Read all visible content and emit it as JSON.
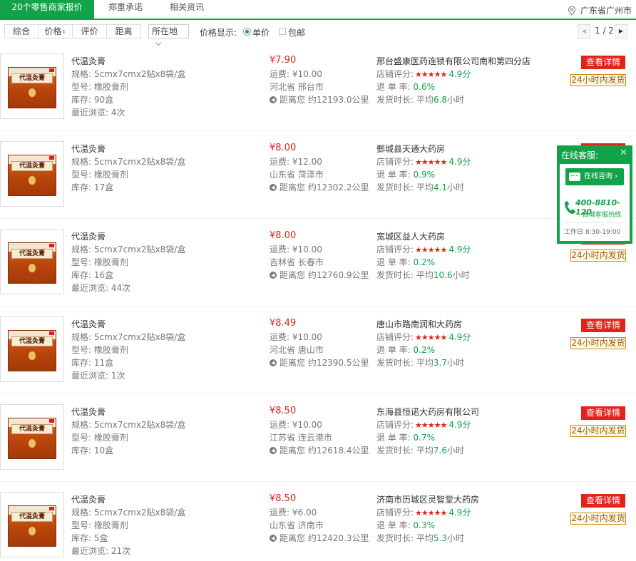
{
  "tabs": [
    {
      "label": "20个零售商家报价",
      "active": true
    },
    {
      "label": "郑重承诺",
      "active": false
    },
    {
      "label": "相关资讯",
      "active": false
    }
  ],
  "location": "广东省广州市",
  "filters": {
    "buttons": [
      "综合",
      "价格",
      "评价",
      "距离"
    ],
    "region_select": "所在地",
    "price_display_label": "价格显示:",
    "unit_price_label": "单价",
    "shipping_label": "包邮"
  },
  "pager": {
    "text": "1 / 2"
  },
  "labels": {
    "spec": "规格:",
    "type": "型号:",
    "stock": "库存:",
    "recent": "最近浏览:",
    "shipping": "运费:",
    "distance_prefix": "距离您 约",
    "rating": "店铺评分:",
    "return_rate": "退 单 率:",
    "ship_time": "发货时长:",
    "avg": "平均",
    "hours": "小时",
    "detail": "查看详情",
    "ship24": "24小时内发货"
  },
  "products": [
    {
      "name": "代温灸膏",
      "spec": "5cmx7cmx2贴x8袋/盒",
      "type": "橡胶膏剂",
      "stock": "90盒",
      "recent": "4次",
      "price": "¥7.90",
      "shipping": "¥10.00",
      "region": "河北省 邢台市",
      "distance": "12193.0公里",
      "store": "邢台盛康医药连锁有限公司南和第四分店",
      "rating": "4.9分",
      "return_rate": "0.6%",
      "ship_hours": "6.8"
    },
    {
      "name": "代温灸膏",
      "spec": "5cmx7cmx2贴x8袋/盒",
      "type": "橡胶膏剂",
      "stock": "17盒",
      "recent": "",
      "price": "¥8.00",
      "shipping": "¥12.00",
      "region": "山东省 菏泽市",
      "distance": "12302.2公里",
      "store": "鄄城县天通大药房",
      "rating": "4.9分",
      "return_rate": "0.9%",
      "ship_hours": "4.1"
    },
    {
      "name": "代温灸膏",
      "spec": "5cmx7cmx2贴x8袋/盒",
      "type": "橡胶膏剂",
      "stock": "16盒",
      "recent": "44次",
      "price": "¥8.00",
      "shipping": "¥10.00",
      "region": "吉林省 长春市",
      "distance": "12760.9公里",
      "store": "宽城区益人大药房",
      "rating": "4.9分",
      "return_rate": "0.2%",
      "ship_hours": "10.6"
    },
    {
      "name": "代温灸膏",
      "spec": "5cmx7cmx2贴x8袋/盒",
      "type": "橡胶膏剂",
      "stock": "11盒",
      "recent": "1次",
      "price": "¥8.49",
      "shipping": "¥10.00",
      "region": "河北省 唐山市",
      "distance": "12390.5公里",
      "store": "唐山市路南润和大药房",
      "rating": "4.9分",
      "return_rate": "0.2%",
      "ship_hours": "3.7"
    },
    {
      "name": "代温灸膏",
      "spec": "5cmx7cmx2贴x8袋/盒",
      "type": "橡胶膏剂",
      "stock": "10盒",
      "recent": "",
      "price": "¥8.50",
      "shipping": "¥10.00",
      "region": "江苏省 连云港市",
      "distance": "12618.4公里",
      "store": "东海县恒诺大药房有限公司",
      "rating": "4.9分",
      "return_rate": "0.7%",
      "ship_hours": "7.6"
    },
    {
      "name": "代温灸膏",
      "spec": "5cmx7cmx2贴x8袋/盒",
      "type": "橡胶膏剂",
      "stock": "5盒",
      "recent": "21次",
      "price": "¥8.50",
      "shipping": "¥6.00",
      "region": "山东省 济南市",
      "distance": "12420.3公里",
      "store": "济南市历城区灵智堂大药房",
      "rating": "4.9分",
      "return_rate": "0.3%",
      "ship_hours": "5.3"
    }
  ],
  "box_label": "代温灸膏",
  "customer_service": {
    "title": "在线客服:",
    "online_label": "在线咨询 ›",
    "hotline": "400-8810-120",
    "hotline_label": "商城客服热线",
    "hours": "工作日 8:30-19:00"
  },
  "colors": {
    "brand_green": "#12a34a",
    "price_red": "#e2231a"
  }
}
